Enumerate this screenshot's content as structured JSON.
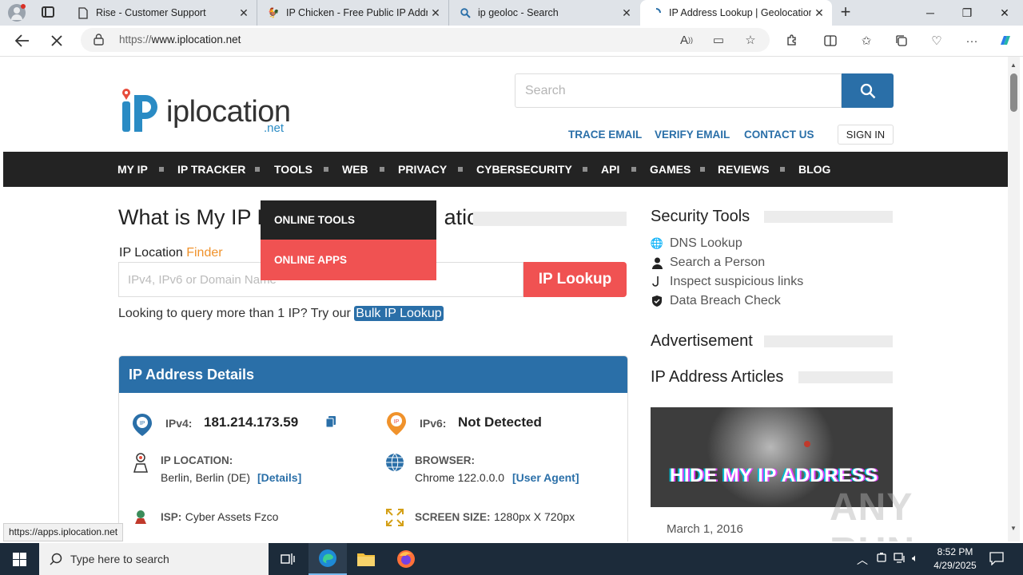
{
  "browser": {
    "tabs": [
      {
        "title": "Rise - Customer Support",
        "icon": "document-icon"
      },
      {
        "title": "IP Chicken - Free Public IP Addre",
        "icon": "chicken-icon"
      },
      {
        "title": "ip geoloc - Search",
        "icon": "search-icon"
      },
      {
        "title": "IP Address Lookup | Geolocation",
        "icon": "loading-icon"
      }
    ],
    "url_prefix": "https://",
    "url_host": "www.iplocation.net",
    "status_url": "https://apps.iplocation.net"
  },
  "header": {
    "logo_main": "iplocation",
    "logo_sub": ".net",
    "search_placeholder": "Search",
    "links": {
      "trace": "TRACE EMAIL",
      "verify": "VERIFY EMAIL",
      "contact": "CONTACT US",
      "signin": "SIGN IN"
    }
  },
  "nav": [
    "MY IP",
    "IP TRACKER",
    "TOOLS",
    "WEB",
    "PRIVACY",
    "CYBERSECURITY",
    "API",
    "GAMES",
    "REVIEWS",
    "BLOG"
  ],
  "dropdown": {
    "item1": "ONLINE TOOLS",
    "item2": "ONLINE APPS"
  },
  "main": {
    "title_left": "What is My IP L",
    "title_right": "ation",
    "finder_label": "IP Location ",
    "finder_highlight": "Finder",
    "input_placeholder": "IPv4, IPv6 or Domain Name",
    "lookup_button": "IP Lookup",
    "bulk_text": "Looking to query more than 1 IP? Try our ",
    "bulk_link": "Bulk IP Lookup"
  },
  "details": {
    "heading": "IP Address Details",
    "ipv4_label": "IPv4:",
    "ipv4_value": "181.214.173.59",
    "ipv6_label": "IPv6:",
    "ipv6_value": "Not Detected",
    "location_label": "IP LOCATION:",
    "location_value": "Berlin, Berlin (DE)",
    "location_link": "[Details]",
    "browser_label": "BROWSER:",
    "browser_value": "Chrome 122.0.0.0",
    "browser_link": "[User Agent]",
    "isp_label": "ISP:",
    "isp_value": "Cyber Assets Fzco",
    "screen_label": "SCREEN SIZE:",
    "screen_value": "1280px X 720px"
  },
  "sidebar": {
    "security_title": "Security Tools",
    "tools": [
      "DNS Lookup",
      "Search a Person",
      "Inspect suspicious links",
      "Data Breach Check"
    ],
    "ad_title": "Advertisement",
    "articles_title": "IP Address Articles",
    "article_image_text": "HIDE MY IP ADDRESS",
    "article_date": "March 1, 2016"
  },
  "watermark": "ANY RUN",
  "taskbar": {
    "search_placeholder": "Type here to search",
    "time": "8:52 PM",
    "date": "4/29/2025"
  },
  "colors": {
    "brand_blue": "#2a6fa8",
    "accent_red": "#f05252",
    "accent_orange": "#f0922b",
    "nav_dark": "#232323"
  }
}
